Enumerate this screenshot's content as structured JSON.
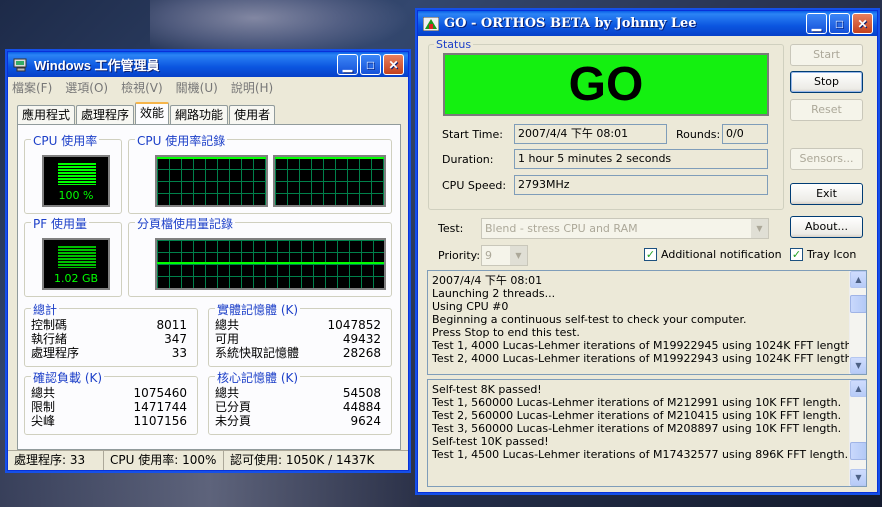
{
  "task_manager": {
    "title": "Windows 工作管理員",
    "menu": [
      "檔案(F)",
      "選項(O)",
      "檢視(V)",
      "關機(U)",
      "說明(H)"
    ],
    "tabs": [
      "應用程式",
      "處理程序",
      "效能",
      "網路功能",
      "使用者"
    ],
    "active_tab": "效能",
    "cpu_usage_title": "CPU 使用率",
    "cpu_usage_value": "100 %",
    "cpu_history_title": "CPU 使用率記錄",
    "pf_usage_title": "PF 使用量",
    "pf_usage_value": "1.02 GB",
    "pf_history_title": "分頁檔使用量記錄",
    "totals": {
      "title": "總計",
      "rows": [
        {
          "label": "控制碼",
          "value": "8011"
        },
        {
          "label": "執行緒",
          "value": "347"
        },
        {
          "label": "處理程序",
          "value": "33"
        }
      ]
    },
    "physical_memory": {
      "title": "實體記憶體 (K)",
      "rows": [
        {
          "label": "總共",
          "value": "1047852"
        },
        {
          "label": "可用",
          "value": "49432"
        },
        {
          "label": "系統快取記憶體",
          "value": "28268"
        }
      ]
    },
    "commit_charge": {
      "title": "確認負載 (K)",
      "rows": [
        {
          "label": "總共",
          "value": "1075460"
        },
        {
          "label": "限制",
          "value": "1471744"
        },
        {
          "label": "尖峰",
          "value": "1107156"
        }
      ]
    },
    "kernel_memory": {
      "title": "核心記憶體 (K)",
      "rows": [
        {
          "label": "總共",
          "value": "54508"
        },
        {
          "label": "已分頁",
          "value": "44884"
        },
        {
          "label": "未分頁",
          "value": "9624"
        }
      ]
    },
    "statusbar": {
      "processes": "處理程序: 33",
      "cpu": "CPU 使用率: 100%",
      "commit": "認可使用: 1050K / 1437K"
    }
  },
  "orthos": {
    "title": "GO - ORTHOS BETA by Johnny Lee",
    "status_legend": "Status",
    "status_text": "GO",
    "start_time_label": "Start Time:",
    "start_time": "2007/4/4 下午 08:01",
    "rounds_label": "Rounds:",
    "rounds": "0/0",
    "duration_label": "Duration:",
    "duration": "1 hour 5 minutes 2 seconds",
    "cpu_speed_label": "CPU Speed:",
    "cpu_speed": "2793MHz",
    "buttons": {
      "start": "Start",
      "stop": "Stop",
      "reset": "Reset",
      "sensors": "Sensors...",
      "exit": "Exit",
      "about": "About..."
    },
    "test_label": "Test:",
    "test_value": "Blend - stress CPU and RAM",
    "priority_label": "Priority:",
    "priority_value": "9",
    "additional_notification": "Additional notification",
    "tray_icon": "Tray Icon",
    "log1": [
      "2007/4/4 下午 08:01",
      "Launching 2 threads...",
      "Using CPU #0",
      "Beginning a continuous self-test to check your computer.",
      "Press Stop to end this test.",
      "Test 1, 4000 Lucas-Lehmer iterations of M19922945 using 1024K FFT length.",
      "Test 2, 4000 Lucas-Lehmer iterations of M19922943 using 1024K FFT length."
    ],
    "log2": [
      "Self-test 8K passed!",
      "Test 1, 560000 Lucas-Lehmer iterations of M212991 using 10K FFT length.",
      "Test 2, 560000 Lucas-Lehmer iterations of M210415 using 10K FFT length.",
      "Test 3, 560000 Lucas-Lehmer iterations of M208897 using 10K FFT length.",
      "Self-test 10K passed!",
      "Test 1, 4500 Lucas-Lehmer iterations of M17432577 using 896K FFT length."
    ]
  }
}
